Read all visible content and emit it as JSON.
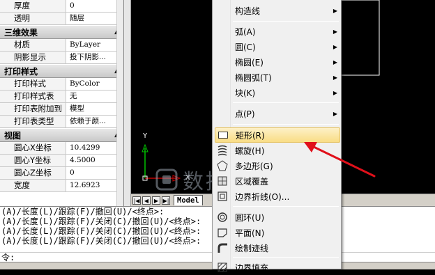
{
  "properties": {
    "rows_top": [
      {
        "key": "厚度",
        "value": "0"
      },
      {
        "key": "透明",
        "value": "随层"
      }
    ],
    "sections": [
      {
        "title": "三维效果",
        "rows": [
          {
            "key": "材质",
            "value": "ByLayer"
          },
          {
            "key": "阴影显示",
            "value": "投下阴影..."
          }
        ]
      },
      {
        "title": "打印样式",
        "rows": [
          {
            "key": "打印样式",
            "value": "ByColor"
          },
          {
            "key": "打印样式表",
            "value": "无"
          },
          {
            "key": "打印表附加到",
            "value": "模型"
          },
          {
            "key": "打印表类型",
            "value": "依赖于颜..."
          }
        ]
      },
      {
        "title": "视图",
        "rows": [
          {
            "key": "圆心X坐标",
            "value": "10.4299"
          },
          {
            "key": "圆心Y坐标",
            "value": "4.5000"
          },
          {
            "key": "圆心Z坐标",
            "value": "0"
          },
          {
            "key": "宽度",
            "value": "12.6923"
          }
        ]
      }
    ],
    "collapse_glyph": "▲"
  },
  "canvas": {
    "axis_x": "X",
    "axis_y": "Y",
    "model_tab": "Model",
    "tab_buttons": [
      "|◀",
      "◀",
      "▶",
      "▶|"
    ]
  },
  "menu": {
    "items": [
      {
        "label": "构造线",
        "icon": "none",
        "submenu": true
      },
      {
        "label": "弧(A)",
        "icon": "none",
        "submenu": true
      },
      {
        "label": "圆(C)",
        "icon": "none",
        "submenu": true
      },
      {
        "label": "椭圆(E)",
        "icon": "none",
        "submenu": true
      },
      {
        "label": "椭圆弧(T)",
        "icon": "none",
        "submenu": true
      },
      {
        "label": "块(K)",
        "icon": "none",
        "submenu": true
      },
      {
        "label": "点(P)",
        "icon": "none",
        "submenu": true
      },
      {
        "label": "矩形(R)",
        "icon": "rectangle-icon",
        "submenu": false,
        "highlighted": true
      },
      {
        "label": "螺旋(H)",
        "icon": "helix-icon",
        "submenu": false
      },
      {
        "label": "多边形(G)",
        "icon": "polygon-icon",
        "submenu": false
      },
      {
        "label": "区域覆盖",
        "icon": "wipeout-icon",
        "submenu": false
      },
      {
        "label": "边界折线(O)...",
        "icon": "boundary-icon",
        "submenu": false
      },
      {
        "label": "圆环(U)",
        "icon": "donut-icon",
        "submenu": false
      },
      {
        "label": "平面(N)",
        "icon": "planar-surface-icon",
        "submenu": false
      },
      {
        "label": "绘制迹线",
        "icon": "trace-icon",
        "submenu": false
      },
      {
        "label": "边界填充",
        "icon": "hatch-icon",
        "submenu": false
      }
    ],
    "submenu_glyph": "▶"
  },
  "command_line": {
    "lines": [
      "(A)/长度(L)/跟踪(F)/撤回(U)/<终点>:",
      "(A)/长度(L)/跟踪(F)/关闭(C)/撤回(U)/<终点>:",
      "(A)/长度(L)/跟踪(F)/关闭(C)/撤回(U)/<终点>:",
      "(A)/长度(L)/跟踪(F)/关闭(C)/撤回(U)/<终点>:"
    ],
    "prompt": "令:"
  },
  "watermark": {
    "text": "数据蛙家"
  },
  "colors": {
    "arrow": "#e0101a",
    "highlight": "#f9dd85",
    "axis": "#00c000"
  }
}
